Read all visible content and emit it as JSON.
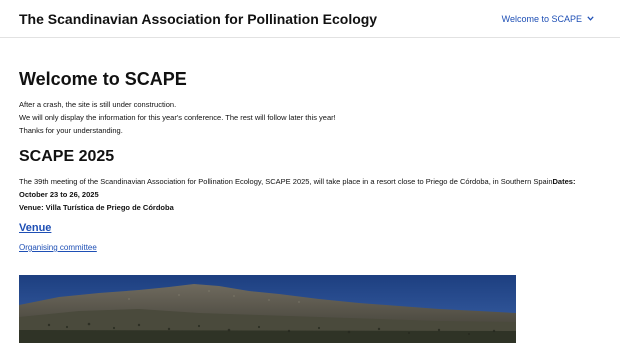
{
  "header": {
    "site_title": "The Scandinavian Association for Pollination Ecology",
    "nav_label": "Welcome to SCAPE"
  },
  "welcome": {
    "title": "Welcome to SCAPE",
    "lines": [
      "After a crash, the site is still under construction.",
      "We will only display the information for this year's conference. The rest will follow later this year!",
      "Thanks for your understanding."
    ]
  },
  "scape2025": {
    "title": "SCAPE 2025",
    "intro": "The 39th meeting of the Scandinavian Association for Pollination Ecology, SCAPE 2025, will take place in a resort close to Priego de Córdoba, in Southern Spain",
    "dates_label": "Dates:",
    "dates_value": "October 23 to 26, 2025",
    "venue_line": "Venue: Villa Turística de Priego de Córdoba"
  },
  "links": {
    "venue": "Venue",
    "organising_committee": "Organising committee"
  },
  "icons": {
    "nav_chevron": "chevron-down-icon"
  },
  "colors": {
    "link": "#1e4fb5",
    "text": "#111111",
    "divider": "#e2e2e2"
  }
}
